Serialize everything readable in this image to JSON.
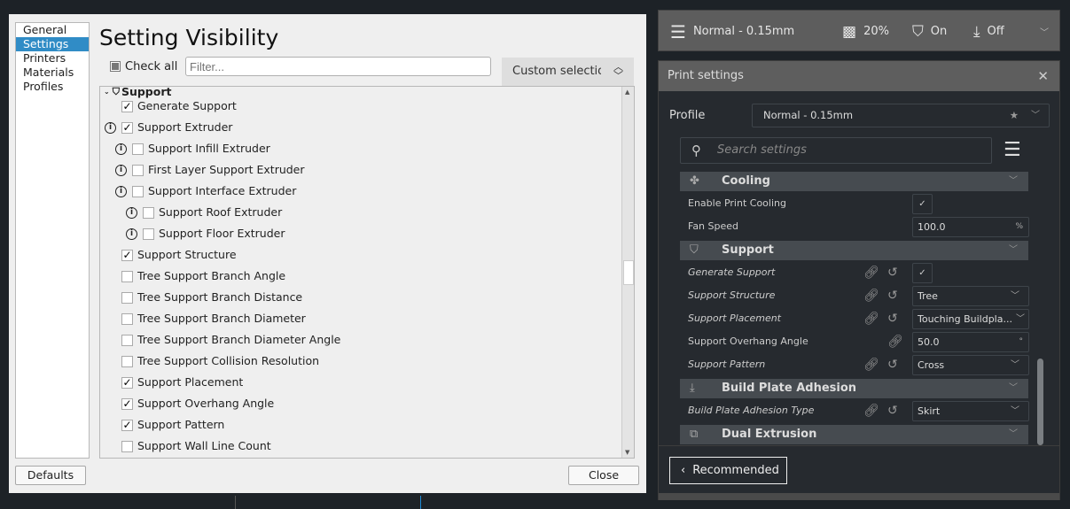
{
  "dialog": {
    "nav": [
      "General",
      "Settings",
      "Printers",
      "Materials",
      "Profiles"
    ],
    "nav_selected": 1,
    "title": "Setting Visibility",
    "check_all": "Check all",
    "filter_placeholder": "Filter...",
    "preset": "Custom selection",
    "category": "Support",
    "rows": [
      {
        "label": "Generate Support",
        "checked": true,
        "info": false,
        "level": 0
      },
      {
        "label": "Support Extruder",
        "checked": true,
        "info": true,
        "level": 0
      },
      {
        "label": "Support Infill Extruder",
        "checked": false,
        "info": true,
        "level": 1
      },
      {
        "label": "First Layer Support Extruder",
        "checked": false,
        "info": true,
        "level": 1
      },
      {
        "label": "Support Interface Extruder",
        "checked": false,
        "info": true,
        "level": 1
      },
      {
        "label": "Support Roof Extruder",
        "checked": false,
        "info": true,
        "level": 2
      },
      {
        "label": "Support Floor Extruder",
        "checked": false,
        "info": true,
        "level": 2
      },
      {
        "label": "Support Structure",
        "checked": true,
        "info": false,
        "level": 0
      },
      {
        "label": "Tree Support Branch Angle",
        "checked": false,
        "info": false,
        "level": 0
      },
      {
        "label": "Tree Support Branch Distance",
        "checked": false,
        "info": false,
        "level": 0
      },
      {
        "label": "Tree Support Branch Diameter",
        "checked": false,
        "info": false,
        "level": 0
      },
      {
        "label": "Tree Support Branch Diameter Angle",
        "checked": false,
        "info": false,
        "level": 0
      },
      {
        "label": "Tree Support Collision Resolution",
        "checked": false,
        "info": false,
        "level": 0
      },
      {
        "label": "Support Placement",
        "checked": true,
        "info": false,
        "level": 0
      },
      {
        "label": "Support Overhang Angle",
        "checked": true,
        "info": false,
        "level": 0
      },
      {
        "label": "Support Pattern",
        "checked": true,
        "info": false,
        "level": 0
      },
      {
        "label": "Support Wall Line Count",
        "checked": false,
        "info": false,
        "level": 0
      }
    ],
    "defaults": "Defaults",
    "close": "Close"
  },
  "topbar": {
    "profile": "Normal - 0.15mm",
    "infill": "20%",
    "support": "On",
    "adhesion": "Off"
  },
  "panel": {
    "title": "Print settings",
    "profile_label": "Profile",
    "profile_value": "Normal - 0.15mm",
    "search_placeholder": "Search settings",
    "categories": {
      "cooling": "Cooling",
      "support": "Support",
      "adhesion": "Build Plate Adhesion",
      "dual": "Dual Extrusion"
    },
    "settings": {
      "enable_cooling": {
        "label": "Enable Print Cooling",
        "checked": true
      },
      "fan_speed": {
        "label": "Fan Speed",
        "value": "100.0",
        "unit": "%"
      },
      "generate_support": {
        "label": "Generate Support",
        "checked": true
      },
      "support_structure": {
        "label": "Support Structure",
        "value": "Tree"
      },
      "support_placement": {
        "label": "Support Placement",
        "value": "Touching Buildpla..."
      },
      "overhang_angle": {
        "label": "Support Overhang Angle",
        "value": "50.0",
        "unit": "°"
      },
      "support_pattern": {
        "label": "Support Pattern",
        "value": "Cross"
      },
      "adhesion_type": {
        "label": "Build Plate Adhesion Type",
        "value": "Skirt"
      }
    },
    "recommended": "Recommended"
  }
}
